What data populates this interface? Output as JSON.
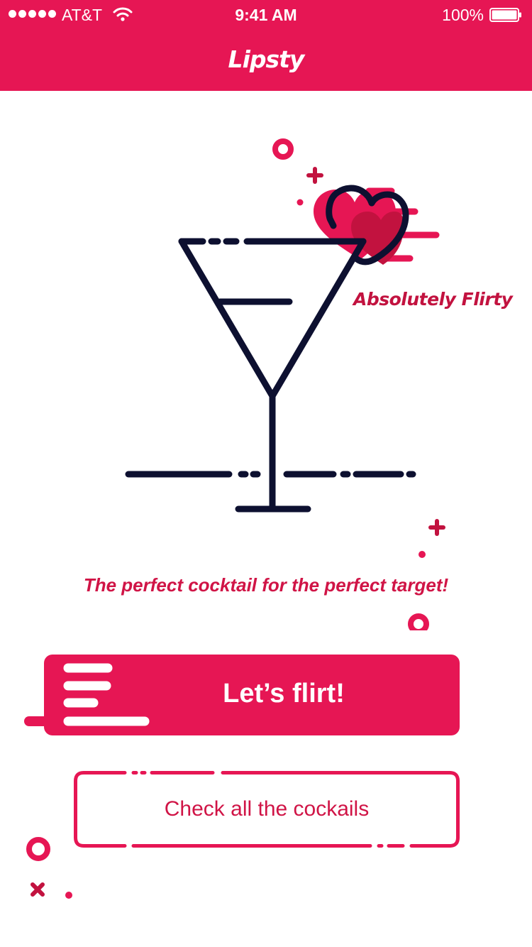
{
  "status_bar": {
    "carrier": "AT&T",
    "time": "9:41 AM",
    "battery_percent": "100%"
  },
  "header": {
    "title": "Lipsty"
  },
  "illustration": {
    "flavor_label": "Absolutely Flirty"
  },
  "tagline": "The perfect cocktail for the perfect target!",
  "actions": {
    "primary_label": "Let’s flirt!",
    "secondary_label": "Check all the cockails"
  },
  "colors": {
    "brand": "#e61654",
    "accent_dark": "#c2123f",
    "ink": "#0d1030",
    "background": "#ffffff"
  }
}
